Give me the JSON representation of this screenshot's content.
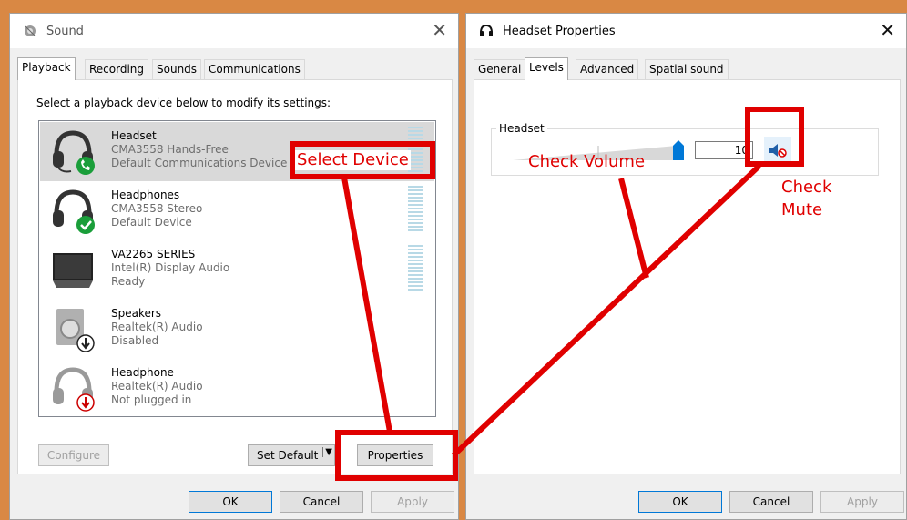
{
  "sound_window": {
    "title": "Sound",
    "tabs": [
      {
        "label": "Playback"
      },
      {
        "label": "Recording"
      },
      {
        "label": "Sounds"
      },
      {
        "label": "Communications"
      }
    ],
    "instruction": "Select a playback device below to modify its settings:",
    "devices": [
      {
        "name": "Headset",
        "line2": "CMA3558 Hands-Free",
        "line3": "Default Communications Device",
        "icon": "headset-icon",
        "status": "phone-badge"
      },
      {
        "name": "Headphones",
        "line2": "CMA3558 Stereo",
        "line3": "Default Device",
        "icon": "headphones-icon",
        "status": "check-badge"
      },
      {
        "name": "VA2265 SERIES",
        "line2": "Intel(R) Display Audio",
        "line3": "Ready",
        "icon": "monitor-icon",
        "status": ""
      },
      {
        "name": "Speakers",
        "line2": "Realtek(R) Audio",
        "line3": "Disabled",
        "icon": "speaker-icon",
        "status": "disabled-badge"
      },
      {
        "name": "Headphone",
        "line2": "Realtek(R) Audio",
        "line3": "Not plugged in",
        "icon": "headphone-icon",
        "status": "unplugged-badge"
      }
    ],
    "buttons": {
      "configure": "Configure",
      "set_default": "Set Default",
      "properties": "Properties",
      "ok": "OK",
      "cancel": "Cancel",
      "apply": "Apply"
    }
  },
  "props_window": {
    "title": "Headset Properties",
    "tabs": [
      {
        "label": "General"
      },
      {
        "label": "Levels"
      },
      {
        "label": "Advanced"
      },
      {
        "label": "Spatial sound"
      }
    ],
    "group_label": "Headset",
    "volume_value": "10",
    "volume_fraction": 0.98,
    "buttons": {
      "ok": "OK",
      "cancel": "Cancel",
      "apply": "Apply"
    }
  },
  "annotations": {
    "select_device": "Select Device",
    "check_volume": "Check Volume",
    "check_mute_1": "Check",
    "check_mute_2": "Mute"
  },
  "colors": {
    "annotation": "#e00000",
    "desktop": "#d98844",
    "accent": "#0078d7"
  }
}
